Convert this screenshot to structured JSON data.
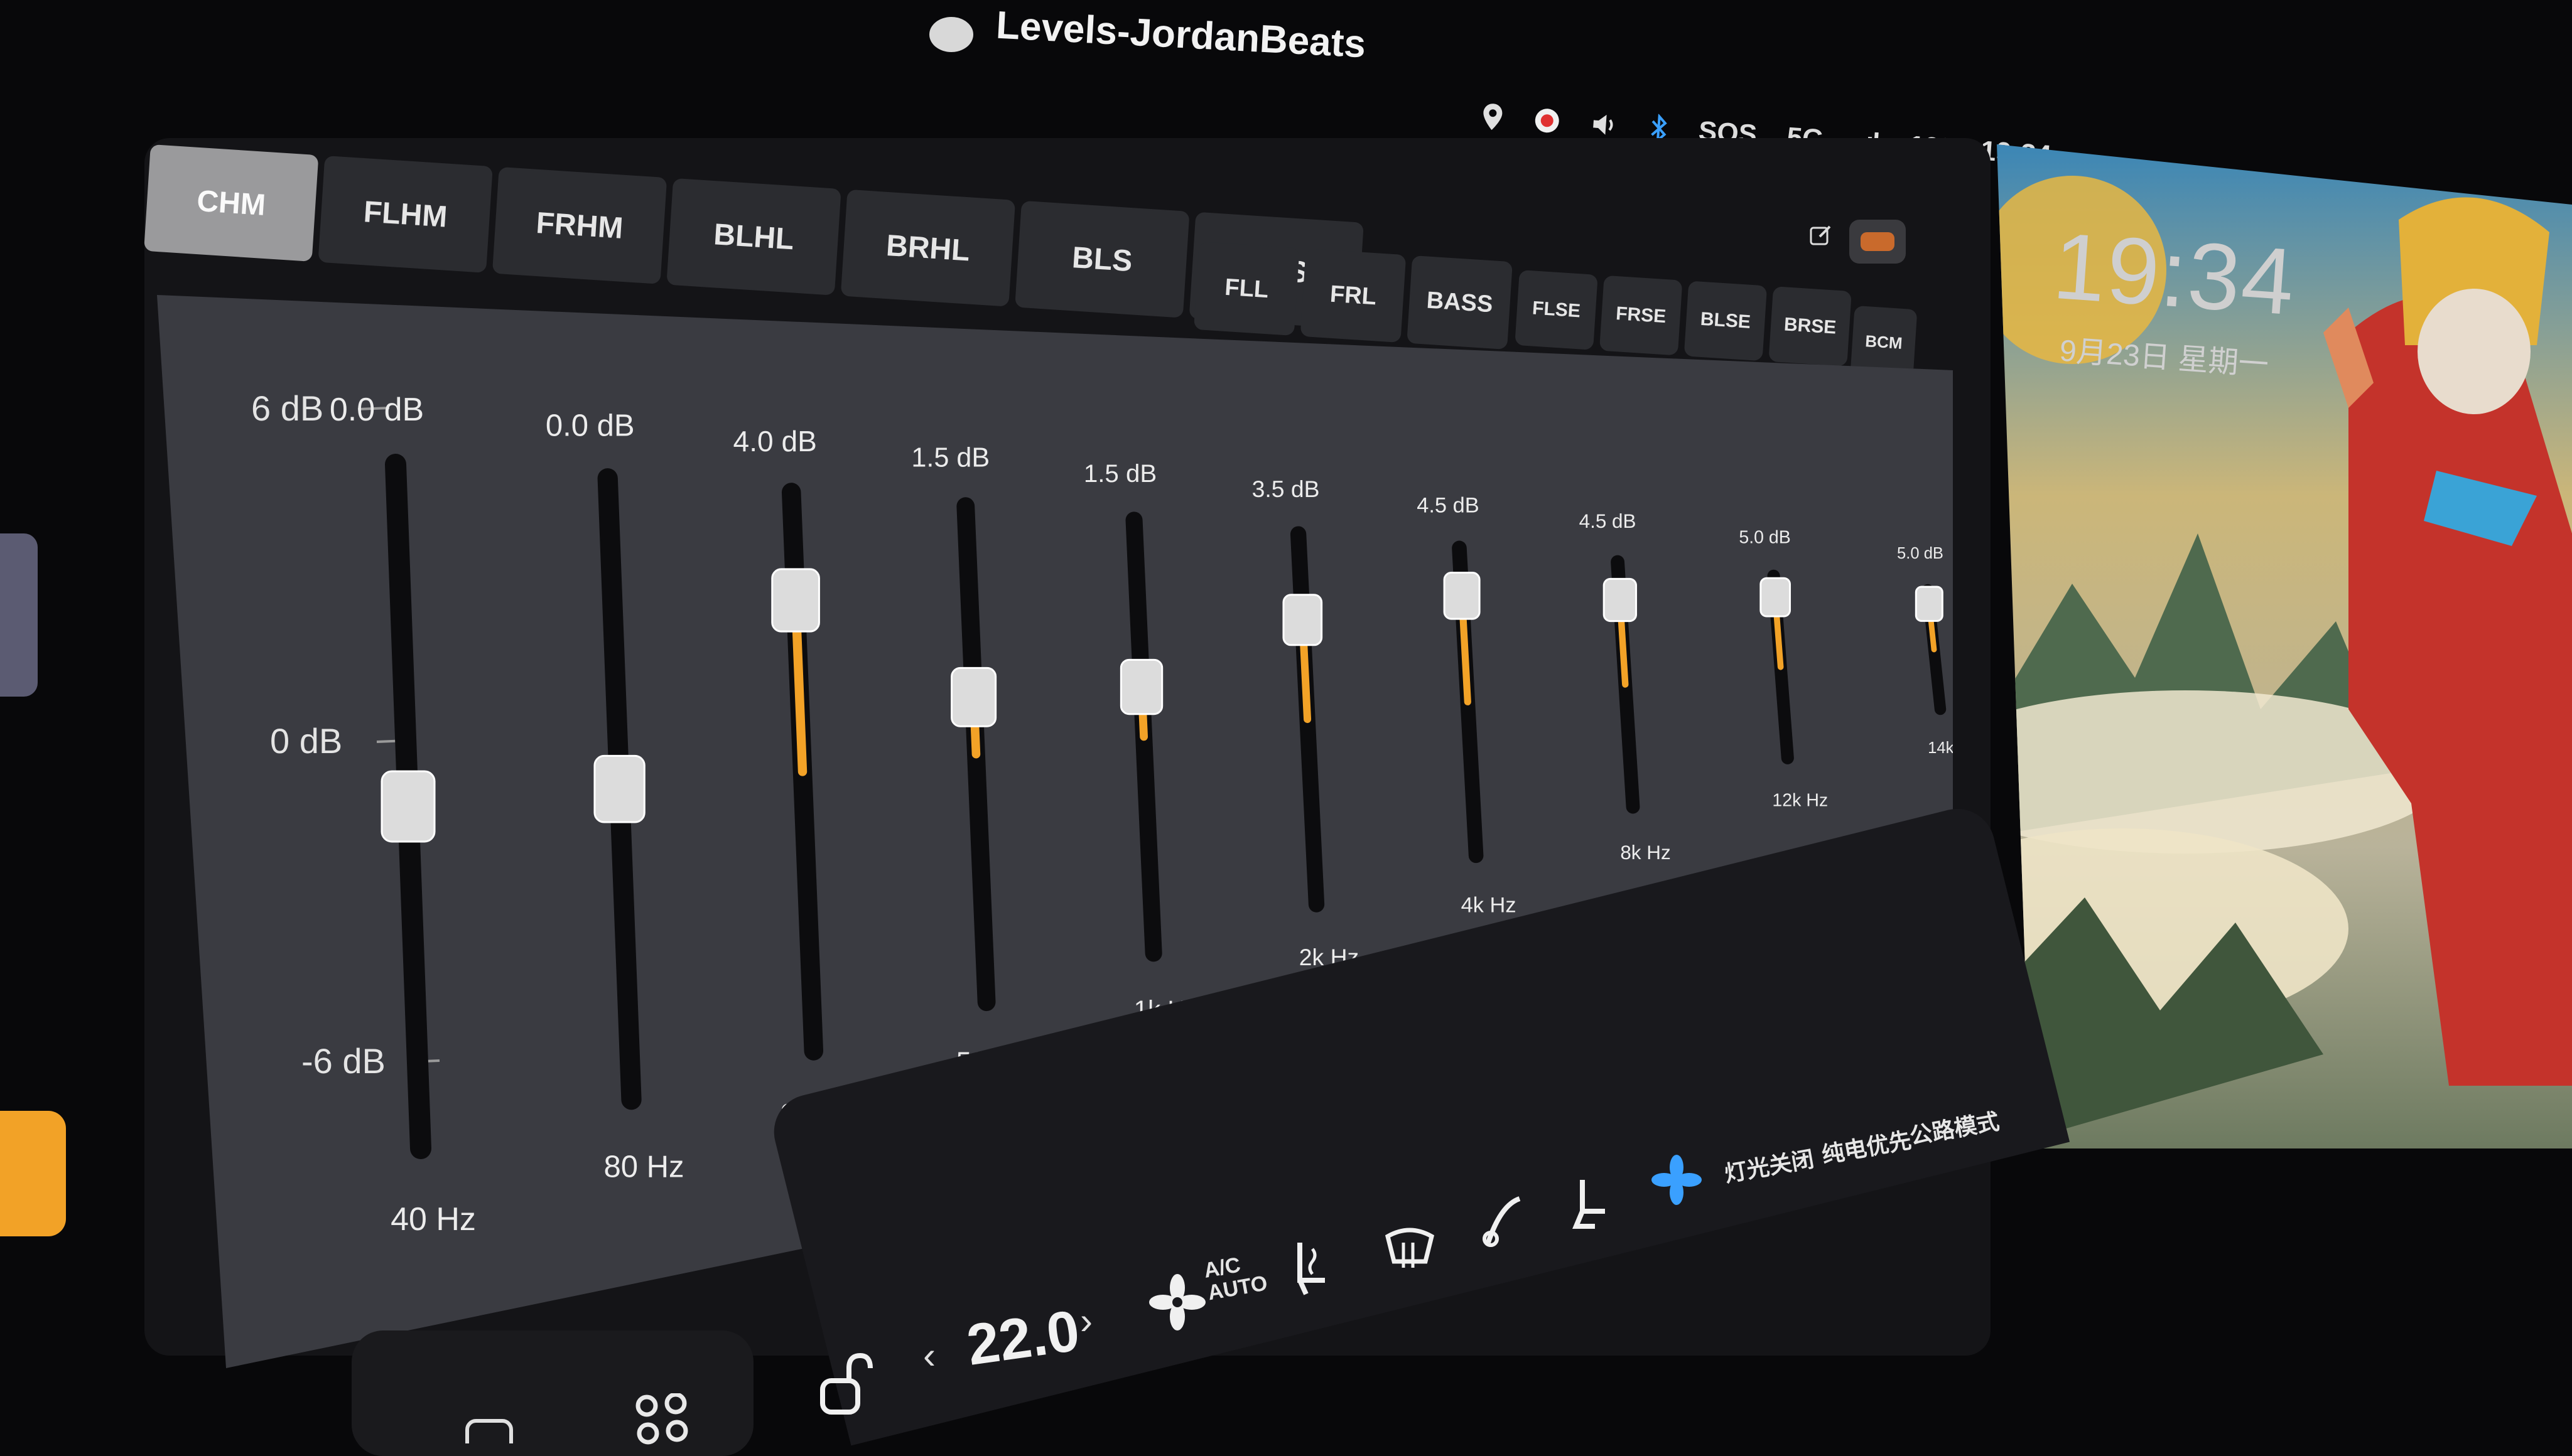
{
  "now_playing": {
    "title": "Levels-JordanBeats"
  },
  "status_bar": {
    "sos": "SOS",
    "network": "5G",
    "temperature": "19°",
    "time": "19:34"
  },
  "tabs_group1": [
    "CHM",
    "FLHM",
    "FRHM",
    "BLHL",
    "BRHL",
    "BLS",
    "BRS"
  ],
  "tabs_group2": [
    "FLL",
    "FRL",
    "BASS"
  ],
  "tabs_group3": [
    "FLSE",
    "FRSE",
    "BLSE",
    "BRSE"
  ],
  "tab_extra": "BCM",
  "active_tab": "CHM",
  "equalizer": {
    "scale_labels": [
      "6 dB",
      "0 dB",
      "-6 dB"
    ],
    "bands": [
      {
        "freq": "40 Hz",
        "gain_label": "0.0 dB",
        "gain": 0.0
      },
      {
        "freq": "80 Hz",
        "gain_label": "0.0 dB",
        "gain": 0.0
      },
      {
        "freq": "250 Hz",
        "gain_label": "4.0 dB",
        "gain": 4.0
      },
      {
        "freq": "500 Hz",
        "gain_label": "1.5 dB",
        "gain": 1.5
      },
      {
        "freq": "1k Hz",
        "gain_label": "1.5 dB",
        "gain": 1.5
      },
      {
        "freq": "2k Hz",
        "gain_label": "3.5 dB",
        "gain": 3.5
      },
      {
        "freq": "4k Hz",
        "gain_label": "4.5 dB",
        "gain": 4.5
      },
      {
        "freq": "8k Hz",
        "gain_label": "4.5 dB",
        "gain": 4.5
      },
      {
        "freq": "12k Hz",
        "gain_label": "5.0 dB",
        "gain": 5.0
      },
      {
        "freq": "14k Hz",
        "gain_label": "5.0 dB",
        "gain": 5.0
      }
    ],
    "colors": {
      "active_track": "#f2a227",
      "track": "#0c0c0e",
      "thumb": "#dcdcdc"
    }
  },
  "wallpaper": {
    "time": "19:34",
    "date": "9月23日 星期一"
  },
  "climate": {
    "temperature": "22.0",
    "decrease_label": "‹",
    "increase_label": "›",
    "ac_auto": "A/C AUTO",
    "quick_options": [
      "灯光关闭",
      "纯电优先",
      "公路模式"
    ]
  },
  "icons": [
    "location-icon",
    "record-icon",
    "volume-icon",
    "bluetooth-icon",
    "signal-icon",
    "edit-icon",
    "toggle-icon",
    "lock-icon",
    "fan-icon",
    "seat-heat-icon",
    "defrost-icon",
    "wiper-icon",
    "seat-vent-icon",
    "fan-blue-icon",
    "app-grid-icon"
  ]
}
